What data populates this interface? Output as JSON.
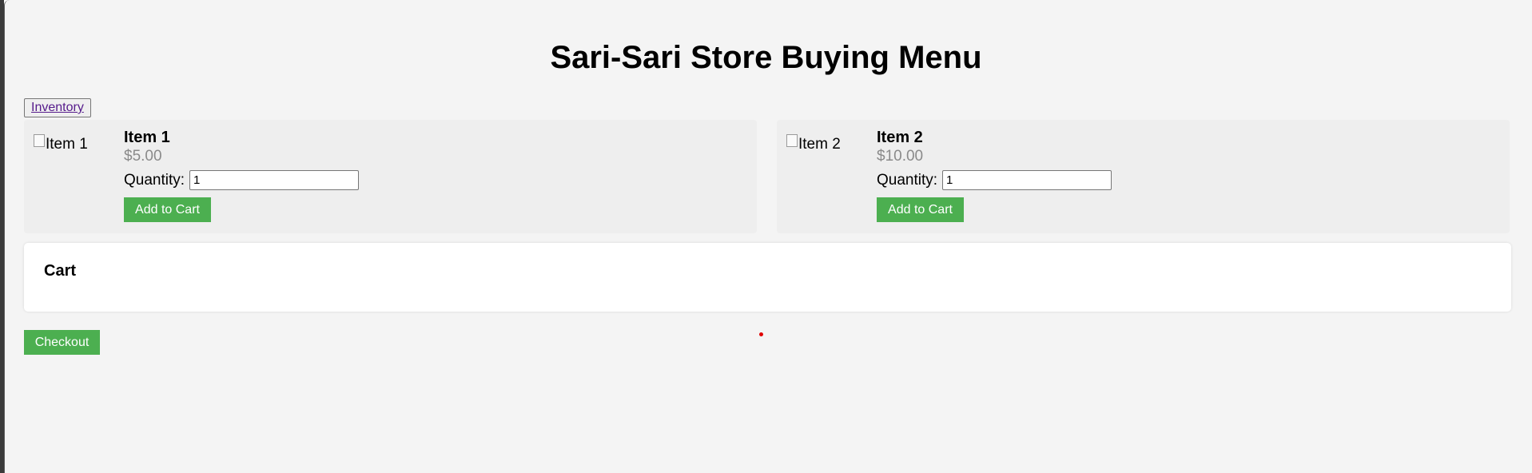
{
  "page": {
    "title": "Sari-Sari Store Buying Menu",
    "inventory_link": "Inventory"
  },
  "products": [
    {
      "image_alt": "Item 1",
      "name": "Item 1",
      "price": "$5.00",
      "quantity_label": "Quantity:",
      "quantity_value": "1",
      "add_button": "Add to Cart"
    },
    {
      "image_alt": "Item 2",
      "name": "Item 2",
      "price": "$10.00",
      "quantity_label": "Quantity:",
      "quantity_value": "1",
      "add_button": "Add to Cart"
    }
  ],
  "cart": {
    "title": "Cart"
  },
  "checkout_button": "Checkout",
  "colors": {
    "background": "#f4f4f4",
    "button_green": "#4caf50",
    "price_gray": "#8a8a8a",
    "link_purple": "#551a8b"
  },
  "icons": {
    "broken_image": "broken-image-icon"
  }
}
